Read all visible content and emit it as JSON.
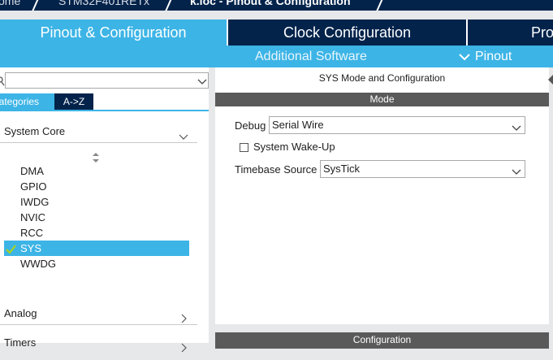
{
  "breadcrumb": {
    "items": [
      "ome",
      "STM32F401RETx",
      "k.ioc - Pinout & Configuration"
    ]
  },
  "tabs": {
    "pinout": "Pinout & Configuration",
    "clock": "Clock Configuration",
    "project": "Pro"
  },
  "subnav": {
    "additional_software": "Additional Software",
    "pinout": "Pinout"
  },
  "left": {
    "search": {
      "value": "",
      "placeholder": ""
    },
    "view_tabs": {
      "categories": "Categories",
      "az": "A->Z"
    },
    "categories": {
      "system_core": "System Core",
      "analog": "Analog",
      "timers": "Timers"
    },
    "items": [
      "DMA",
      "GPIO",
      "IWDG",
      "NVIC",
      "RCC",
      "SYS",
      "WWDG"
    ],
    "selected_item": "SYS"
  },
  "right": {
    "title": "SYS Mode and Configuration",
    "mode_header": "Mode",
    "debug_label": "Debug",
    "debug_value": "Serial Wire",
    "wakeup_label": "System Wake-Up",
    "wakeup_checked": false,
    "timebase_label": "Timebase Source",
    "timebase_value": "SysTick",
    "config_header": "Configuration"
  },
  "colors": {
    "accent": "#3cb4e6",
    "navy": "#03234b",
    "header_gray": "#5a5a5a",
    "check_green": "#a6d41e"
  },
  "icons": [
    "search-icon",
    "chevron-down-icon",
    "chevron-right-icon",
    "sort-icon",
    "check-icon"
  ]
}
